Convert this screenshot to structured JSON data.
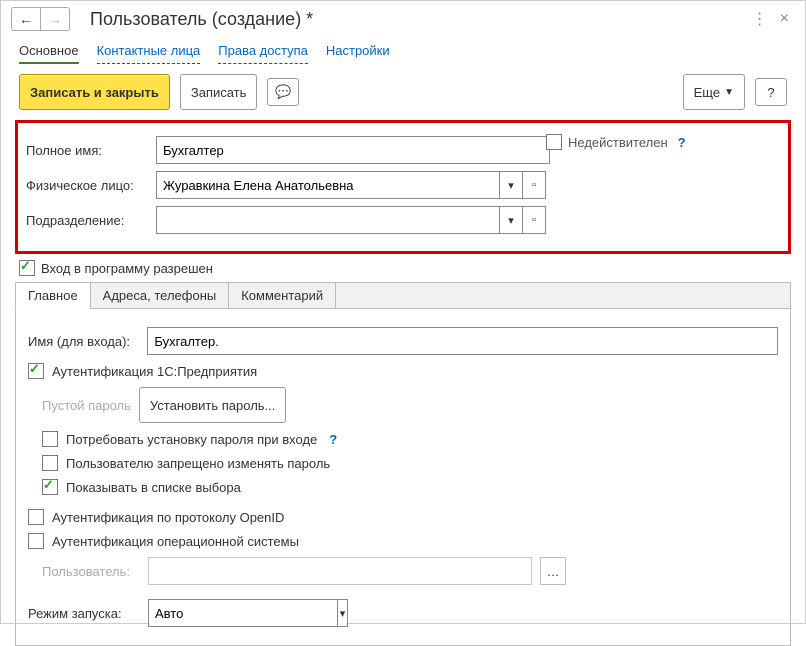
{
  "title": "Пользователь (создание) *",
  "tabs_top": {
    "main": "Основное",
    "contacts": "Контактные лица",
    "access": "Права доступа",
    "settings": "Настройки"
  },
  "toolbar": {
    "save_close": "Записать и закрыть",
    "save": "Записать",
    "more": "Еще",
    "help": "?"
  },
  "fields": {
    "fullname_label": "Полное имя:",
    "fullname_value": "Бухгалтер",
    "person_label": "Физическое лицо:",
    "person_value": "Журавкина Елена Анатольевна",
    "department_label": "Подразделение:",
    "department_value": "",
    "inactive_label": "Недействителен",
    "login_allowed_label": "Вход в программу разрешен"
  },
  "inner_tabs": {
    "main": "Главное",
    "addresses": "Адреса, телефоны",
    "comment": "Комментарий"
  },
  "main_tab": {
    "login_label": "Имя (для входа):",
    "login_value": "Бухгалтер.",
    "auth1c_label": "Аутентификация 1С:Предприятия",
    "empty_pwd": "Пустой пароль",
    "set_pwd": "Установить пароль...",
    "require_pwd": "Потребовать установку пароля при входе",
    "forbid_change_pwd": "Пользователю запрещено изменять пароль",
    "show_in_list": "Показывать в списке выбора",
    "auth_openid": "Аутентификация по протоколу OpenID",
    "auth_os": "Аутентификация операционной системы",
    "os_user_label": "Пользователь:",
    "os_user_value": "",
    "launch_mode_label": "Режим запуска:",
    "launch_mode_value": "Авто"
  },
  "help_q": "?"
}
